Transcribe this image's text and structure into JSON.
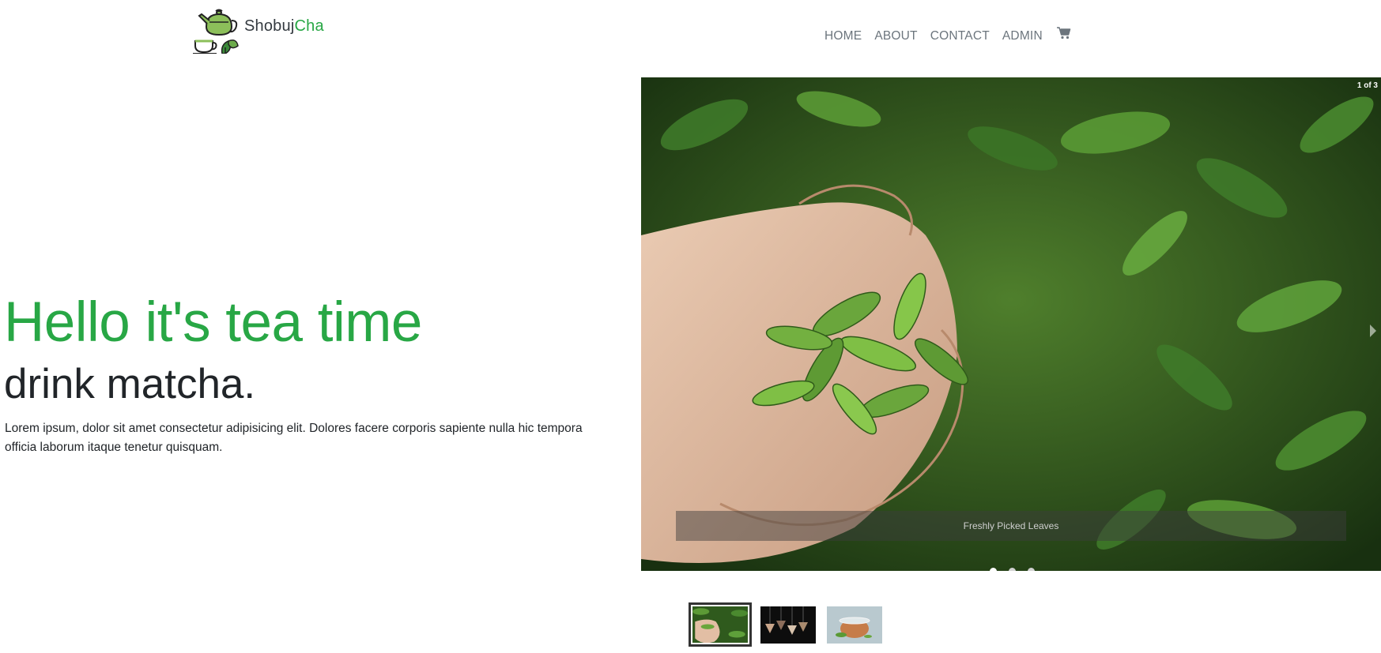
{
  "brand": {
    "name_part1": "Shobuj",
    "name_part2": "Cha",
    "logo": "teapot-cup-logo",
    "accent_color": "#28a745"
  },
  "nav": {
    "items": [
      {
        "label": "HOME"
      },
      {
        "label": "ABOUT"
      },
      {
        "label": "CONTACT"
      },
      {
        "label": "ADMIN"
      }
    ],
    "cart_icon": "shopping-cart-icon"
  },
  "hero": {
    "title": "Hello it's tea time",
    "subtitle": "drink matcha.",
    "body": "Lorem ipsum, dolor sit amet consectetur adipisicing elit. Dolores facere corporis sapiente nulla hic tempora officia laborum itaque tenetur quisquam."
  },
  "carousel": {
    "counter": "1 of 3",
    "caption": "Freshly Picked Leaves",
    "slide_count": 3,
    "active_index": 0,
    "next_icon": "chevron-right-icon"
  },
  "thumbnails": [
    {
      "name": "hands-with-tea-leaves"
    },
    {
      "name": "hanging-tea-bags"
    },
    {
      "name": "glass-cup-of-tea"
    }
  ]
}
